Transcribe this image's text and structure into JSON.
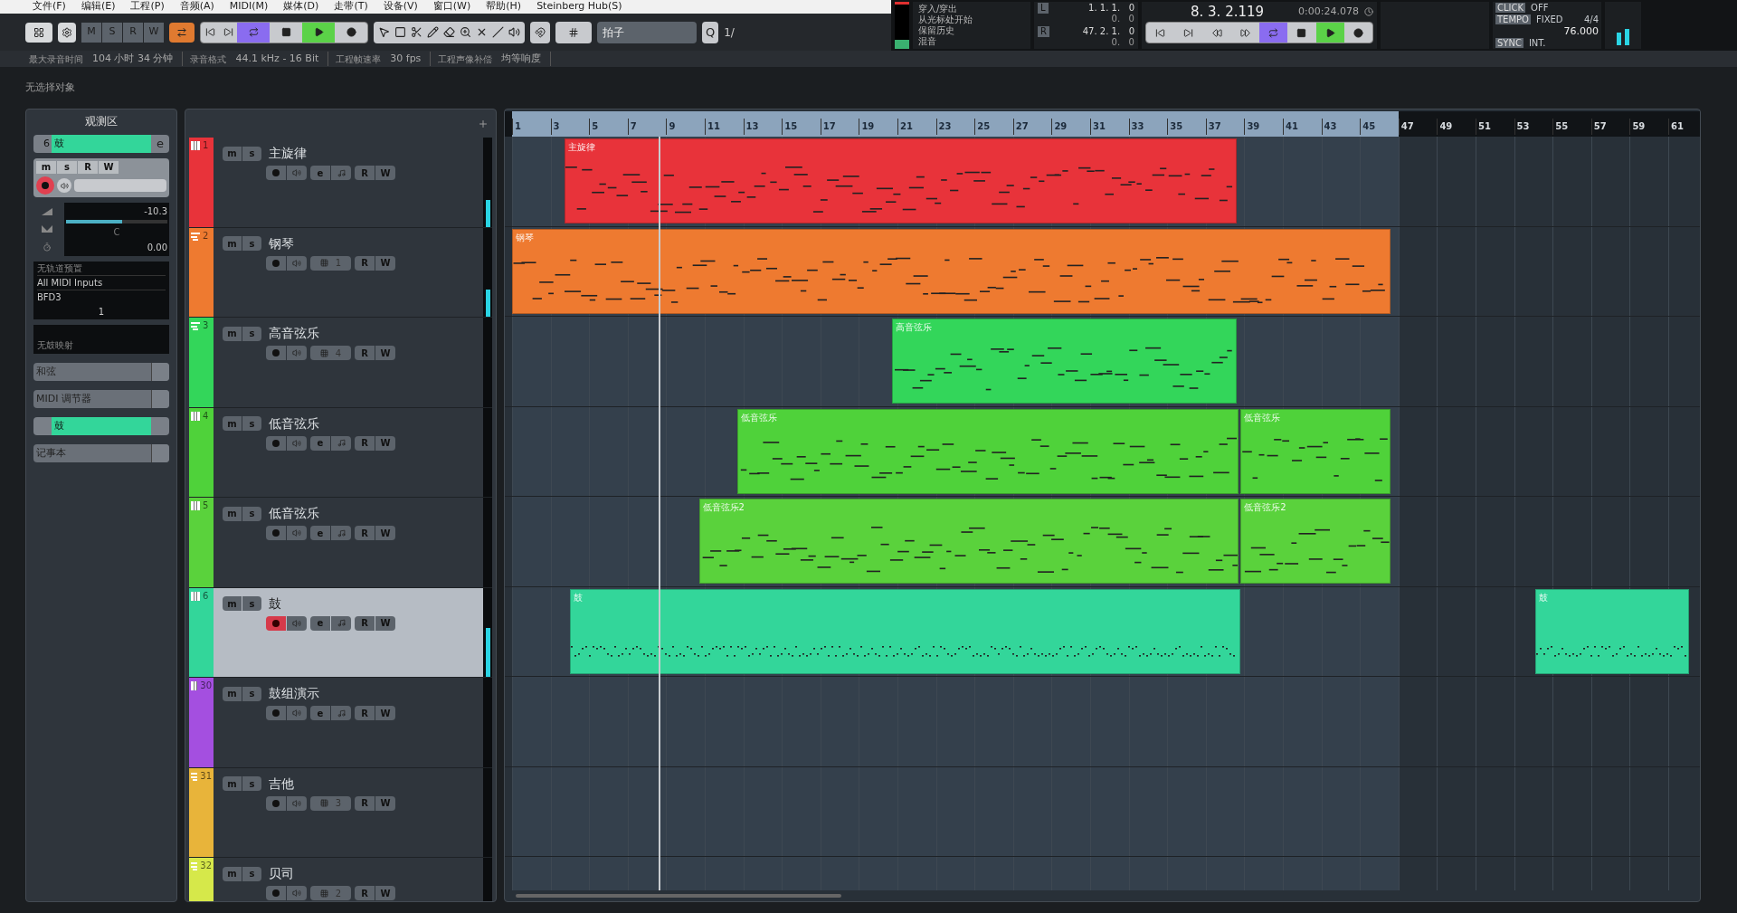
{
  "menu": [
    "文件(F)",
    "编辑(E)",
    "工程(P)",
    "音频(A)",
    "MIDI(M)",
    "媒体(D)",
    "走带(T)",
    "设备(V)",
    "窗口(W)",
    "帮助(H)",
    "Steinberg Hub(S)"
  ],
  "toolbar": {
    "msrw": [
      "M",
      "S",
      "R",
      "W"
    ],
    "grid_type": "拍子",
    "quantize": "Q",
    "quantize_value": "1/"
  },
  "info_bar": [
    {
      "label": "最大录音时间",
      "value": "104 小时 34 分钟"
    },
    {
      "label": "录音格式",
      "value": "44.1 kHz - 16 Bit"
    },
    {
      "label": "工程帧速率",
      "value": "30 fps"
    },
    {
      "label": "工程声像补偿",
      "value": "均等响度"
    }
  ],
  "status": "无选择对象",
  "transport": {
    "modes": [
      "穿入/穿出",
      "从光标处开始",
      "保留历史",
      "混音"
    ],
    "left_locator": {
      "label": "L",
      "position": "1. 1. 1.   0",
      "offset": "0.   0"
    },
    "right_locator": {
      "label": "R",
      "position": "47. 2. 1.   0",
      "offset": "0.   0"
    },
    "position": "8. 3. 2.119",
    "time": "0:00:24.078",
    "click": {
      "label": "CLICK",
      "value": "OFF"
    },
    "tempo": {
      "label": "TEMPO",
      "value": "FIXED",
      "signature": "4/4",
      "bpm": "76.000"
    },
    "sync": {
      "label": "SYNC",
      "value": "INT."
    }
  },
  "inspector": {
    "title": "观测区",
    "track_number": "6",
    "track_name": "鼓",
    "buttons": [
      "m",
      "s",
      "R",
      "W"
    ],
    "edit": "e",
    "volume": {
      "reading": "-10.3",
      "level": 0.55
    },
    "pan": {
      "reading": "C"
    },
    "delay": {
      "reading": "0.00"
    },
    "preset": "无轨道预置",
    "input": "All MIDI Inputs",
    "output": "BFD3",
    "channel": "1",
    "drum_map": "无鼓映射",
    "sections": [
      {
        "kind": "plain",
        "label": "和弦"
      },
      {
        "kind": "plain",
        "label": "MIDI 调节器"
      },
      {
        "kind": "track",
        "label": "鼓"
      },
      {
        "kind": "plain",
        "label": "记事本"
      }
    ]
  },
  "tracks": [
    {
      "number": "1",
      "name": "主旋律",
      "kind": "instrument",
      "mute": "m",
      "solo": "s",
      "edit": "e",
      "read": "R",
      "write": "W",
      "color": "#e8333a",
      "selected": false,
      "armed": false,
      "level": 0.3,
      "parts": [
        {
          "label": "主旋律"
        }
      ]
    },
    {
      "number": "2",
      "name": "钢琴",
      "kind": "midi",
      "mute": "m",
      "solo": "s",
      "channel": "1",
      "read": "R",
      "write": "W",
      "color": "#ee7a30",
      "selected": false,
      "armed": false,
      "level": 0.3,
      "parts": [
        {
          "label": "钢琴"
        }
      ]
    },
    {
      "number": "3",
      "name": "高音弦乐",
      "kind": "midi",
      "mute": "m",
      "solo": "s",
      "channel": "4",
      "read": "R",
      "write": "W",
      "color": "#33d65a",
      "selected": false,
      "armed": false,
      "level": 0,
      "parts": [
        {
          "label": "高音弦乐"
        }
      ]
    },
    {
      "number": "4",
      "name": "低音弦乐",
      "kind": "instrument",
      "mute": "m",
      "solo": "s",
      "edit": "e",
      "read": "R",
      "write": "W",
      "color": "#4fd23a",
      "selected": false,
      "armed": false,
      "level": 0,
      "parts": [
        {
          "label": "低音弦乐"
        },
        {
          "label": "低音弦乐"
        }
      ]
    },
    {
      "number": "5",
      "name": "低音弦乐",
      "kind": "instrument",
      "mute": "m",
      "solo": "s",
      "edit": "e",
      "read": "R",
      "write": "W",
      "color": "#5ad23c",
      "selected": false,
      "armed": false,
      "level": 0,
      "parts": [
        {
          "label": "低音弦乐2"
        },
        {
          "label": "低音弦乐2"
        }
      ]
    },
    {
      "number": "6",
      "name": "鼓",
      "kind": "instrument",
      "mute": "m",
      "solo": "s",
      "edit": "e",
      "read": "R",
      "write": "W",
      "color": "#33d69a",
      "selected": true,
      "armed": true,
      "level": 0.55,
      "parts": [
        {
          "label": "鼓"
        },
        {
          "label": "鼓"
        }
      ]
    },
    {
      "number": "30",
      "name": "鼓组演示",
      "kind": "instrument",
      "mute": "m",
      "solo": "s",
      "edit": "e",
      "read": "R",
      "write": "W",
      "color": "#a44fe0",
      "selected": false,
      "armed": false,
      "level": 0
    },
    {
      "number": "31",
      "name": "吉他",
      "kind": "midi",
      "mute": "m",
      "solo": "s",
      "channel": "3",
      "read": "R",
      "write": "W",
      "color": "#e8b43a",
      "selected": false,
      "armed": false,
      "level": 0
    },
    {
      "number": "32",
      "name": "贝司",
      "kind": "midi",
      "mute": "m",
      "solo": "s",
      "channel": "2",
      "read": "R",
      "write": "W",
      "color": "#d6e84a",
      "selected": false,
      "armed": false,
      "level": 0
    }
  ],
  "ruler": [
    "1",
    "3",
    "5",
    "7",
    "9",
    "11",
    "13",
    "15",
    "17",
    "19",
    "21",
    "23",
    "25",
    "27",
    "29",
    "31",
    "33",
    "35",
    "37",
    "39",
    "41",
    "43",
    "45",
    "47",
    "49",
    "51",
    "53",
    "55",
    "57",
    "59",
    "61"
  ]
}
